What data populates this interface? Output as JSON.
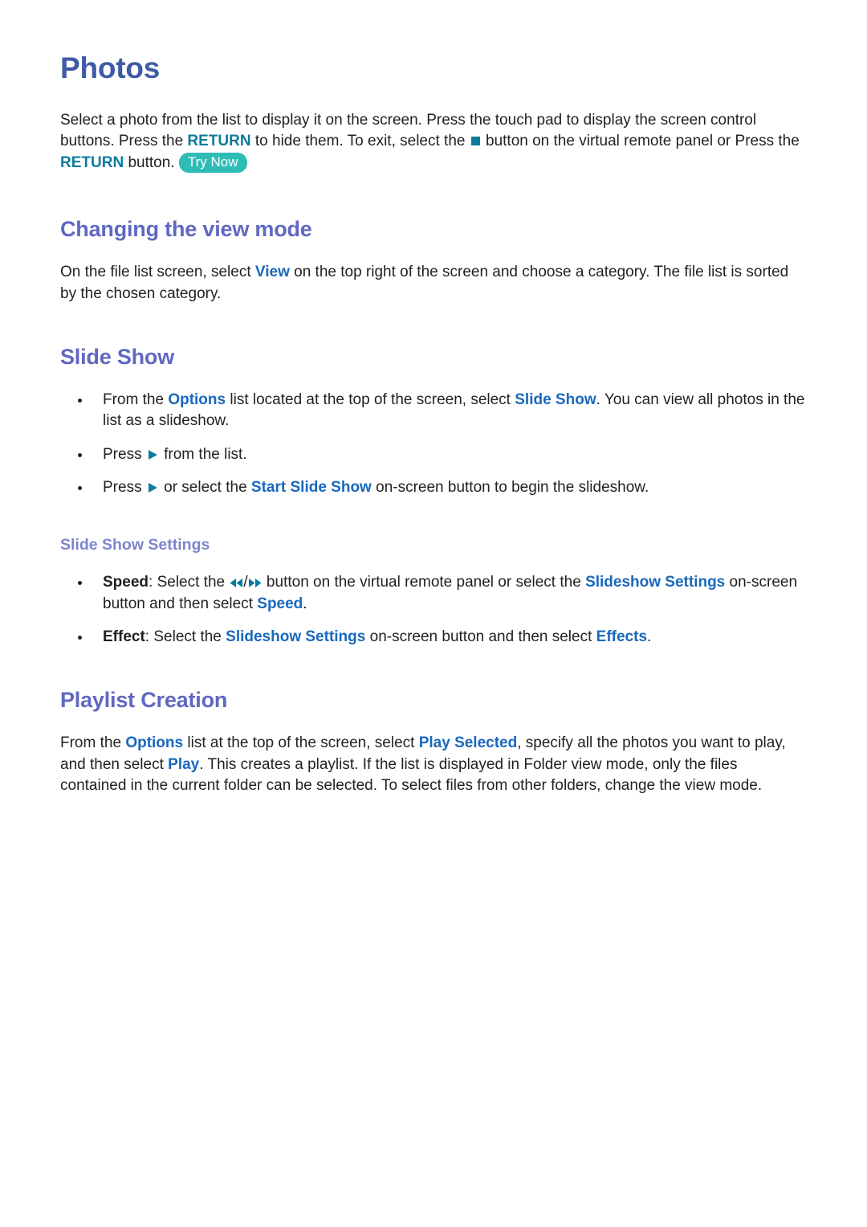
{
  "document": {
    "title": "Photos",
    "intro": {
      "t1": "Select a photo from the list to display it on the screen. Press the touch pad to display the screen control buttons. Press the ",
      "return1": "RETURN",
      "t2": " to hide them. To exit, select the ",
      "t3": " button on the virtual remote panel or Press the ",
      "return2": "RETURN",
      "t4": " button. ",
      "try_now": "Try Now"
    },
    "sections": [
      {
        "heading": "Changing the view mode",
        "body": {
          "t1": "On the file list screen, select ",
          "link1": "View",
          "t2": " on the top right of the screen and choose a category. The file list is sorted by the chosen category."
        }
      },
      {
        "heading": "Slide Show",
        "bullets": [
          {
            "t1": "From the ",
            "link1": "Options",
            "t2": " list located at the top of the screen, select ",
            "link2": "Slide Show",
            "t3": ". You can view all photos in the list as a slideshow."
          },
          {
            "t1": "Press ",
            "t2": " from the list."
          },
          {
            "t1": "Press ",
            "t2": " or select the ",
            "link1": "Start Slide Show",
            "t3": " on-screen button to begin the slideshow."
          }
        ],
        "subsection": {
          "heading": "Slide Show Settings",
          "bullets": [
            {
              "label": "Speed",
              "t1": ": Select the ",
              "t2": " button on the virtual remote panel or select the ",
              "link1": "Slideshow Settings",
              "t3": " on-screen button and then select ",
              "link2": "Speed",
              "t4": "."
            },
            {
              "label": "Effect",
              "t1": ": Select the ",
              "link1": "Slideshow Settings",
              "t2": " on-screen button and then select ",
              "link2": "Effects",
              "t3": "."
            }
          ]
        }
      },
      {
        "heading": "Playlist Creation",
        "body": {
          "t1": "From the ",
          "link1": "Options",
          "t2": " list at the top of the screen, select ",
          "link2": "Play Selected",
          "t3": ", specify all the photos you want to play, and then select ",
          "link3": "Play",
          "t4": ". This creates a playlist. If the list is displayed in Folder view mode, only the files contained in the current folder can be selected. To select files from other folders, change the view mode."
        }
      }
    ],
    "icons": {
      "stop": "stop-square-icon",
      "play": "play-triangle-icon",
      "rewind": "rewind-double-arrow-icon",
      "fast_forward": "fast-forward-double-arrow-icon"
    },
    "colors": {
      "title": "#3f5aa6",
      "heading": "#5f68c2",
      "subheading": "#7d85cd",
      "link_blue": "#1868bd",
      "link_teal": "#0c7c9e",
      "badge_bg": "#2ebdb6",
      "body_text": "#231f20"
    }
  }
}
